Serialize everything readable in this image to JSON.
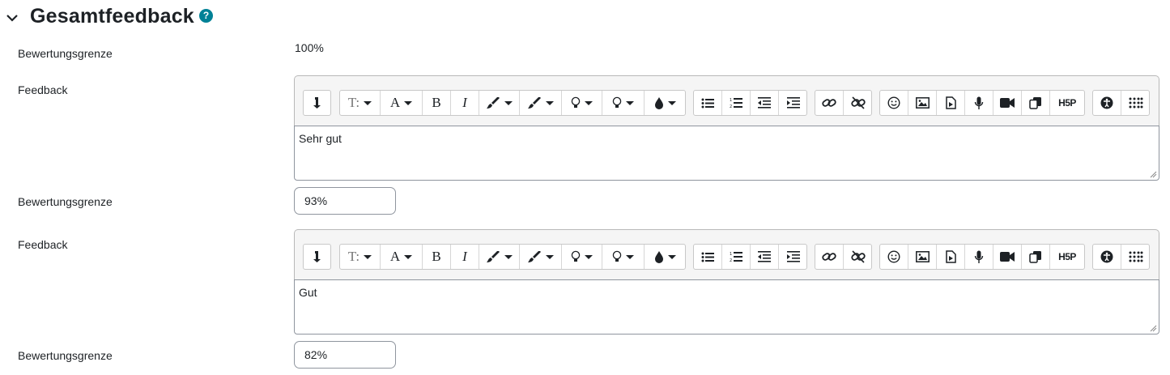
{
  "section": {
    "title": "Gesamtfeedback"
  },
  "rows": [
    {
      "label": "Bewertungsgrenze",
      "value": "100%"
    },
    {
      "label": "Feedback",
      "text": "Sehr gut"
    },
    {
      "label": "Bewertungsgrenze",
      "value": "93%"
    },
    {
      "label": "Feedback",
      "text": "Gut"
    },
    {
      "label": "Bewertungsgrenze",
      "value": "82%"
    }
  ],
  "toolbar": {
    "bold": "B",
    "italic": "I",
    "font_letter": "A",
    "h5p": "H5P"
  },
  "colors": {
    "help": "#008196",
    "border": "#8f959e"
  }
}
